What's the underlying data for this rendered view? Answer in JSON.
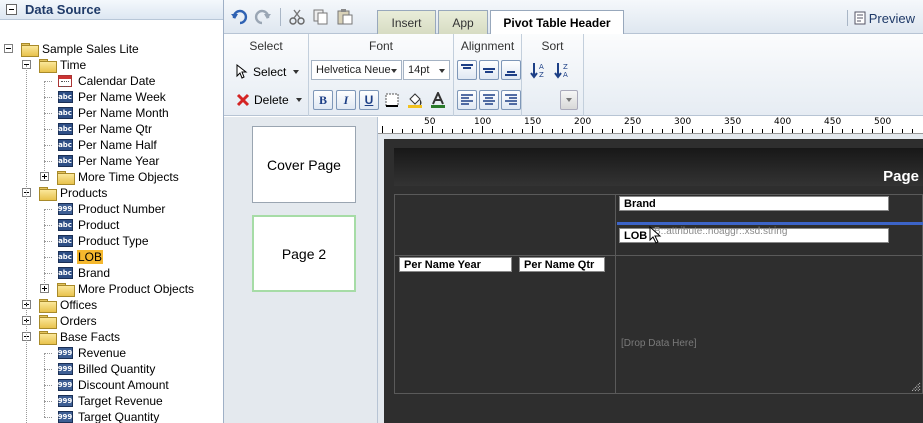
{
  "data_source": {
    "title": "Data Source",
    "tree": [
      {
        "label": "Sample Sales Lite",
        "icon": "folder",
        "level": 0,
        "expander": "minus"
      },
      {
        "label": "Time",
        "icon": "folder",
        "level": 1,
        "expander": "minus"
      },
      {
        "label": "Calendar Date",
        "icon": "calendar",
        "level": 2
      },
      {
        "label": "Per Name Week",
        "icon": "abc",
        "level": 2
      },
      {
        "label": "Per Name Month",
        "icon": "abc",
        "level": 2
      },
      {
        "label": "Per Name Qtr",
        "icon": "abc",
        "level": 2
      },
      {
        "label": "Per Name Half",
        "icon": "abc",
        "level": 2
      },
      {
        "label": "Per Name Year",
        "icon": "abc",
        "level": 2
      },
      {
        "label": "More Time Objects",
        "icon": "folder",
        "level": 2,
        "expander": "plus"
      },
      {
        "label": "Products",
        "icon": "folder",
        "level": 1,
        "expander": "minus"
      },
      {
        "label": "Product Number",
        "icon": "num",
        "level": 2
      },
      {
        "label": "Product",
        "icon": "abc",
        "level": 2
      },
      {
        "label": "Product Type",
        "icon": "abc",
        "level": 2
      },
      {
        "label": "LOB",
        "icon": "abc",
        "level": 2,
        "selected": true
      },
      {
        "label": "Brand",
        "icon": "abc",
        "level": 2
      },
      {
        "label": "More Product Objects",
        "icon": "folder",
        "level": 2,
        "expander": "plus"
      },
      {
        "label": "Offices",
        "icon": "folder",
        "level": 1,
        "expander": "plus"
      },
      {
        "label": "Orders",
        "icon": "folder",
        "level": 1,
        "expander": "plus"
      },
      {
        "label": "Base Facts",
        "icon": "folder",
        "level": 1,
        "expander": "minus"
      },
      {
        "label": "Revenue",
        "icon": "num",
        "level": 2
      },
      {
        "label": "Billed Quantity",
        "icon": "num",
        "level": 2
      },
      {
        "label": "Discount Amount",
        "icon": "num",
        "level": 2
      },
      {
        "label": "Target Revenue",
        "icon": "num",
        "level": 2
      },
      {
        "label": "Target Quantity",
        "icon": "num",
        "level": 2
      },
      {
        "label": "Calculated Facts",
        "icon": "folder",
        "level": 1,
        "expander": "plus"
      }
    ]
  },
  "tabs": [
    {
      "label": "Insert",
      "active": false
    },
    {
      "label": "App",
      "active": false
    },
    {
      "label": "Pivot Table Header",
      "active": true
    }
  ],
  "preview_label": "Preview",
  "ribbon": {
    "select_group": "Select",
    "select_btn": "Select",
    "delete_btn": "Delete",
    "font_group": "Font",
    "font_family": "Helvetica Neue",
    "font_size": "14pt",
    "alignment_group": "Alignment",
    "sort_group": "Sort",
    "bold": "B",
    "italic": "I",
    "underline": "U"
  },
  "page_thumbs": [
    {
      "label": "Cover Page"
    },
    {
      "label": "Page 2"
    }
  ],
  "ruler_labels": [
    "50",
    "100",
    "150",
    "200",
    "250",
    "300",
    "350",
    "400",
    "450",
    "500"
  ],
  "canvas": {
    "page_label": "Page",
    "column_field": "Brand",
    "column_field_drag": "LOB",
    "drag_hint": "B::attribute::noaggr::xsd:string",
    "row_fields": [
      "Per Name Year",
      "Per Name Qtr"
    ],
    "drop_data": "[Drop Data Here]"
  }
}
